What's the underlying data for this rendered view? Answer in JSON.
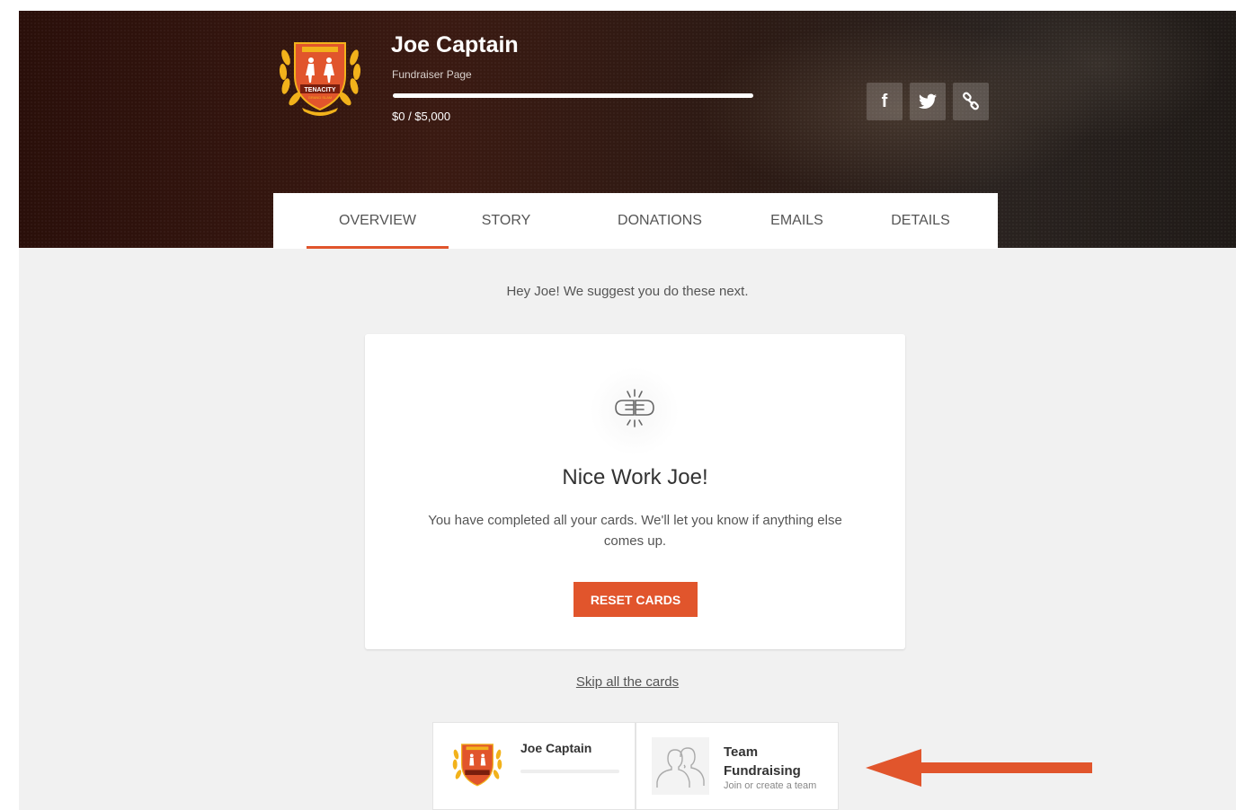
{
  "header": {
    "name": "Joe Captain",
    "subtitle": "Fundraiser Page",
    "amount": "$0 / $5,000",
    "progress_fraction": 0,
    "logo_lettering": "TENACITY GRAND SLAM"
  },
  "social": [
    {
      "icon": "facebook-icon",
      "glyph": "f"
    },
    {
      "icon": "twitter-icon"
    },
    {
      "icon": "link-icon"
    }
  ],
  "tabs": [
    "OVERVIEW",
    "STORY",
    "DONATIONS",
    "EMAILS",
    "DETAILS"
  ],
  "active_tab": "OVERVIEW",
  "overview": {
    "suggestion": "Hey Joe! We suggest you do these next.",
    "card": {
      "icon": "fist-bump-icon",
      "title": "Nice Work Joe!",
      "text": "You have completed all your cards. We'll let you know if anything else comes up.",
      "button": "RESET CARDS"
    },
    "skip": "Skip all the cards"
  },
  "mini_cards": {
    "profile": {
      "name": "Joe Captain"
    },
    "team": {
      "title": "Team Fundraising",
      "subtitle": "Join or create a team",
      "icon": "team-people-icon"
    }
  },
  "colors": {
    "accent": "#e1552c",
    "background": "#f1f1f1",
    "hero_dark": "#2a0f0a"
  }
}
